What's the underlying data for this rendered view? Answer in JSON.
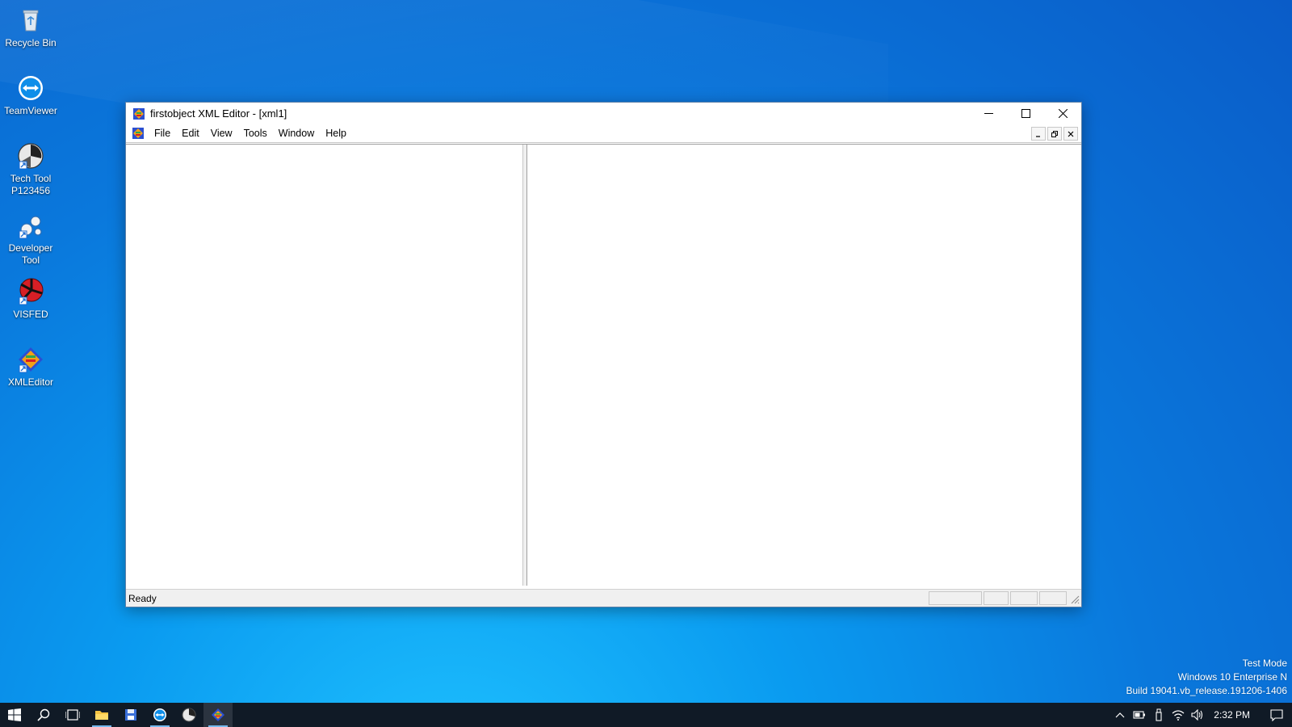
{
  "desktop": {
    "icons": [
      {
        "label": "Recycle Bin",
        "icon": "recycle-bin-icon"
      },
      {
        "label": "TeamViewer",
        "icon": "teamviewer-icon"
      },
      {
        "label": "Tech Tool\nP123456",
        "icon": "tech-tool-icon"
      },
      {
        "label": "Developer\nTool",
        "icon": "developer-tool-icon"
      },
      {
        "label": "VISFED",
        "icon": "visfed-icon"
      },
      {
        "label": "XMLEditor",
        "icon": "xmleditor-icon"
      }
    ],
    "watermark": {
      "line1": "Test Mode",
      "line2": "Windows 10 Enterprise N",
      "line3": "Build 19041.vb_release.191206-1406"
    }
  },
  "window": {
    "title": "firstobject XML Editor - [xml1]",
    "menu": [
      "File",
      "Edit",
      "View",
      "Tools",
      "Window",
      "Help"
    ],
    "status_text": "Ready"
  },
  "taskbar": {
    "apps": [
      "start-icon",
      "search-icon",
      "task-view-icon",
      "file-explorer-icon",
      "save-app-icon",
      "teamviewer-icon",
      "tech-tool-icon",
      "xmleditor-icon"
    ],
    "active_app": "xmleditor-icon",
    "clock": "2:32 PM"
  },
  "colors": {
    "desktop_blue": "#0a78dc",
    "taskbar": "#101a26",
    "accent": "#76b9ed"
  }
}
